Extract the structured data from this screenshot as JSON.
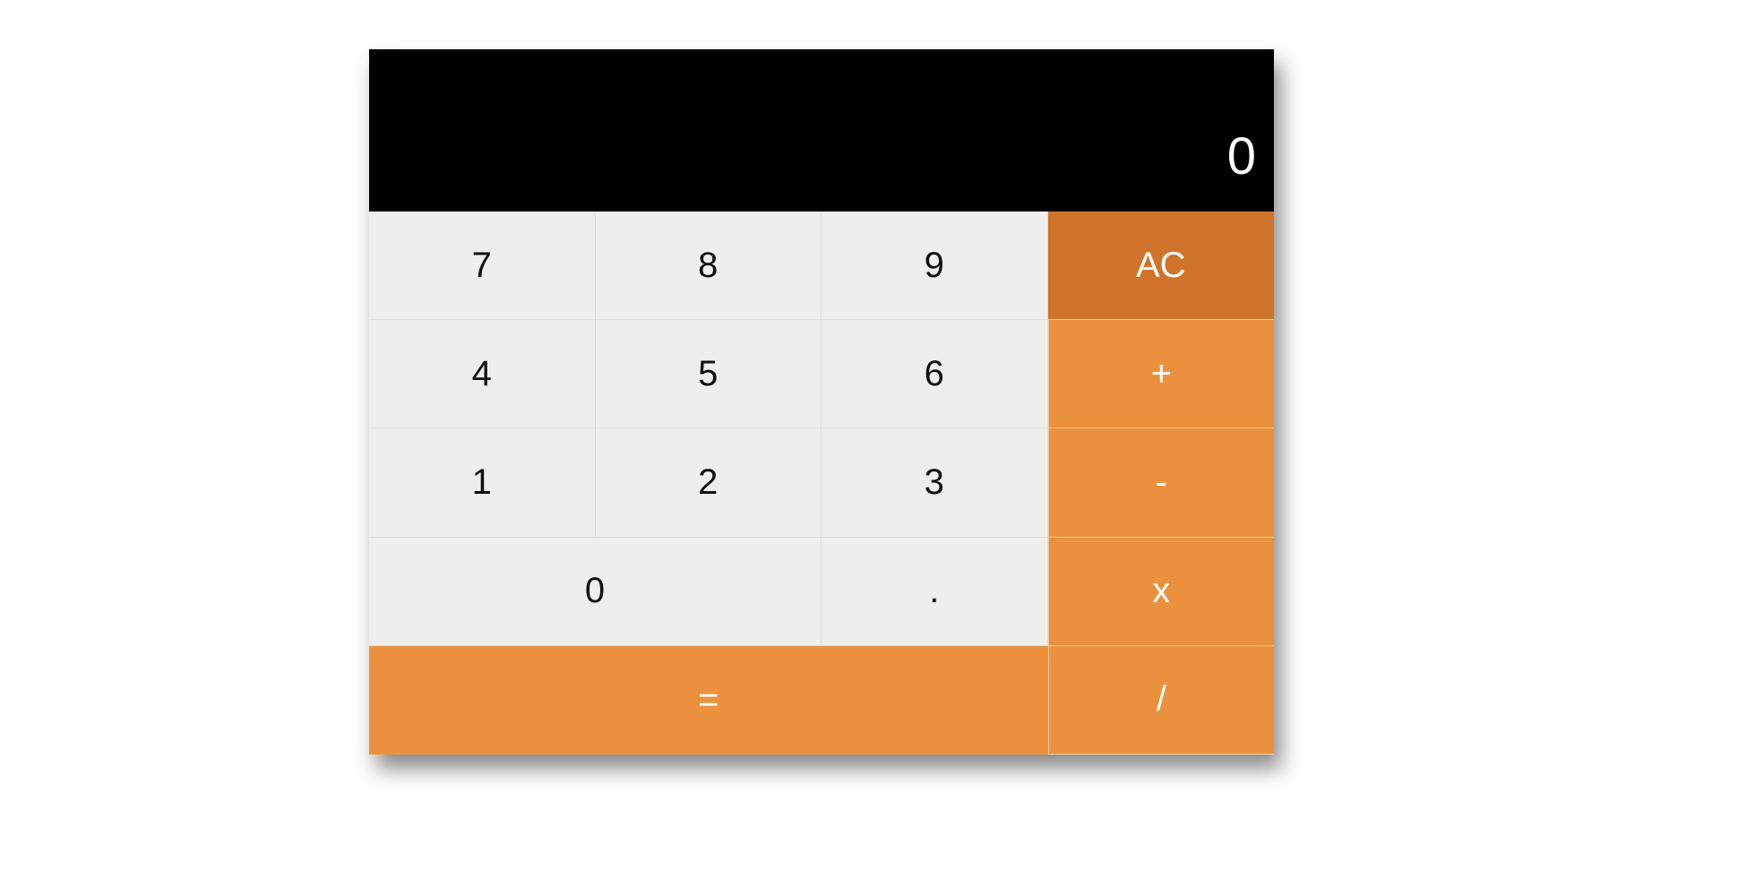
{
  "display": {
    "value": "0"
  },
  "keys": {
    "seven": "7",
    "eight": "8",
    "nine": "9",
    "clear": "AC",
    "four": "4",
    "five": "5",
    "six": "6",
    "plus": "+",
    "one": "1",
    "two": "2",
    "three": "3",
    "minus": "-",
    "zero": "0",
    "decimal": ".",
    "multiply": "x",
    "equals": "=",
    "divide": "/"
  },
  "colors": {
    "display_bg": "#000000",
    "digit_bg": "#eeeeee",
    "operator_bg": "#eb913d",
    "clear_bg": "#d1742b"
  }
}
